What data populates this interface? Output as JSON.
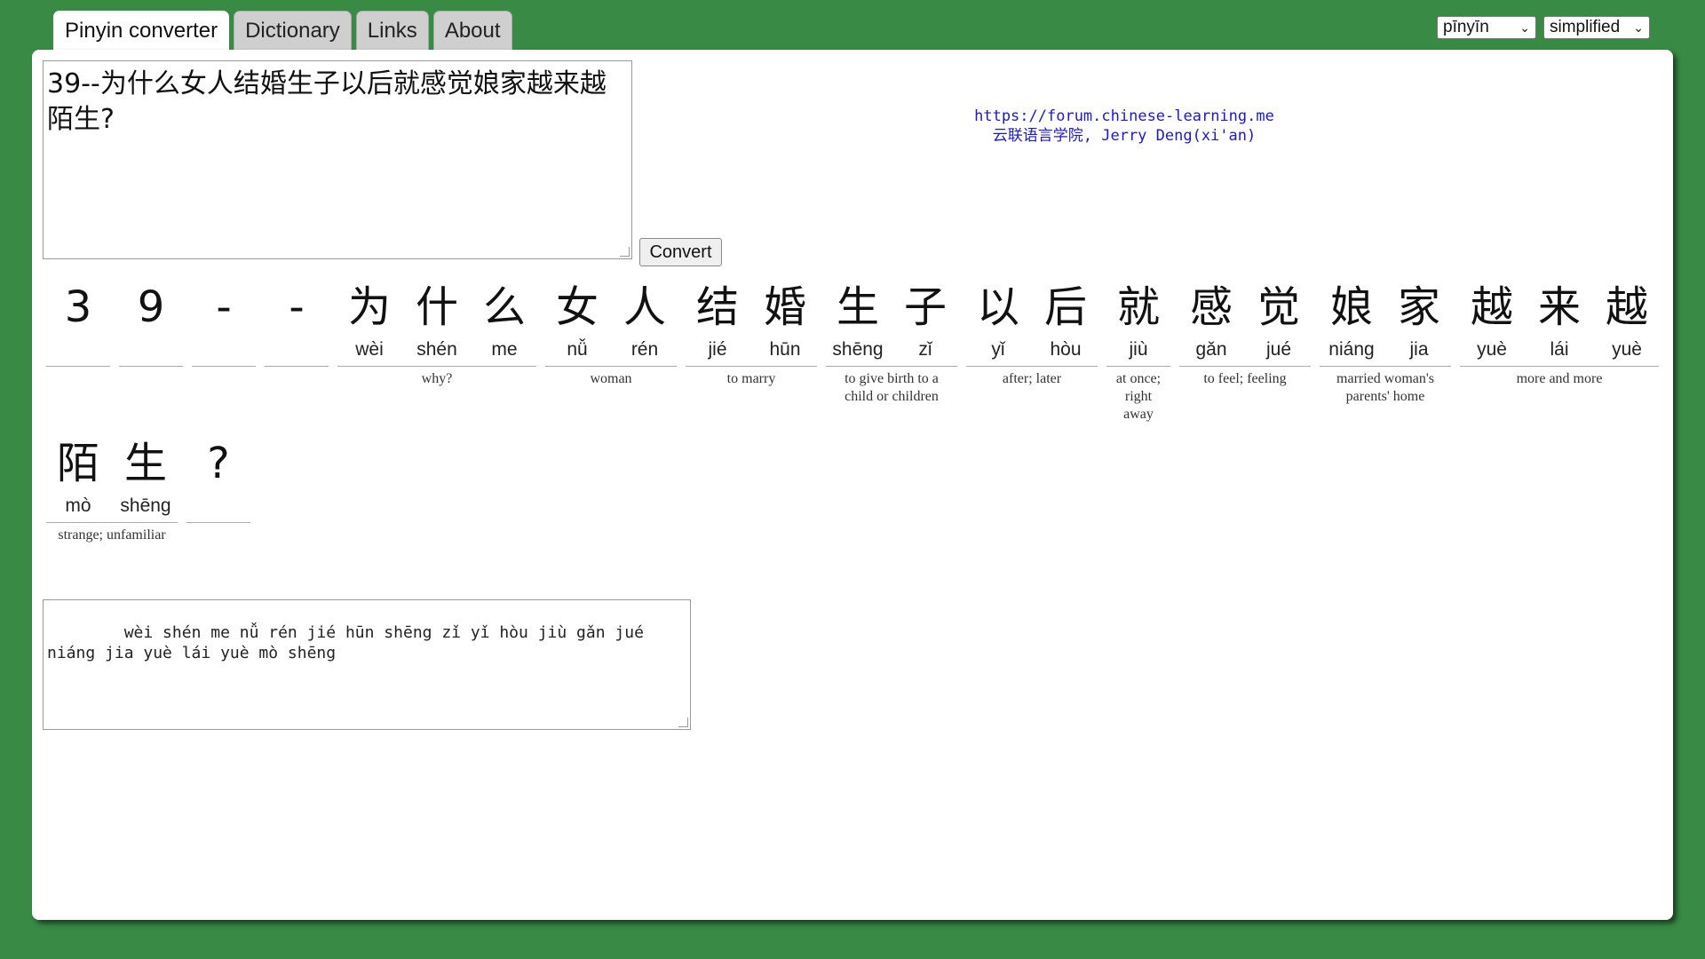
{
  "tabs": [
    "Pinyin converter",
    "Dictionary",
    "Links",
    "About"
  ],
  "selects": {
    "mode": "pīnyīn",
    "script": "simplified"
  },
  "input_text": "39--为什么女人结婚生子以后就感觉娘家越来越陌生?",
  "convert_label": "Convert",
  "credits": {
    "url": "https://forum.chinese-learning.me",
    "attribution": "云联语言学院, Jerry Deng(xi'an)"
  },
  "row1": [
    {
      "chars": [
        {
          "hz": "3",
          "py": ""
        }
      ],
      "def": ""
    },
    {
      "chars": [
        {
          "hz": "9",
          "py": ""
        }
      ],
      "def": ""
    },
    {
      "chars": [
        {
          "hz": "-",
          "py": ""
        }
      ],
      "def": ""
    },
    {
      "chars": [
        {
          "hz": "-",
          "py": ""
        }
      ],
      "def": ""
    },
    {
      "chars": [
        {
          "hz": "为",
          "py": "wèi"
        },
        {
          "hz": "什",
          "py": "shén"
        },
        {
          "hz": "么",
          "py": "me"
        }
      ],
      "def": "why?"
    },
    {
      "chars": [
        {
          "hz": "女",
          "py": "nǚ"
        },
        {
          "hz": "人",
          "py": "rén"
        }
      ],
      "def": "woman"
    },
    {
      "chars": [
        {
          "hz": "结",
          "py": "jié"
        },
        {
          "hz": "婚",
          "py": "hūn"
        }
      ],
      "def": "to marry"
    },
    {
      "chars": [
        {
          "hz": "生",
          "py": "shēng"
        },
        {
          "hz": "子",
          "py": "zǐ"
        }
      ],
      "def": "to give birth to a child or children"
    },
    {
      "chars": [
        {
          "hz": "以",
          "py": "yǐ"
        },
        {
          "hz": "后",
          "py": "hòu"
        }
      ],
      "def": "after; later"
    },
    {
      "chars": [
        {
          "hz": "就",
          "py": "jiù"
        }
      ],
      "def": "at once; right away"
    },
    {
      "chars": [
        {
          "hz": "感",
          "py": "gǎn"
        },
        {
          "hz": "觉",
          "py": "jué"
        }
      ],
      "def": "to feel; feeling"
    },
    {
      "chars": [
        {
          "hz": "娘",
          "py": "niáng"
        },
        {
          "hz": "家",
          "py": "jia"
        }
      ],
      "def": "married woman's parents' home"
    },
    {
      "chars": [
        {
          "hz": "越",
          "py": "yuè"
        },
        {
          "hz": "来",
          "py": "lái"
        },
        {
          "hz": "越",
          "py": "yuè"
        }
      ],
      "def": "more and more"
    }
  ],
  "row2": [
    {
      "chars": [
        {
          "hz": "陌",
          "py": "mò"
        },
        {
          "hz": "生",
          "py": "shēng"
        }
      ],
      "def": "strange; unfamiliar"
    },
    {
      "chars": [
        {
          "hz": "?",
          "py": ""
        }
      ],
      "def": ""
    }
  ],
  "output_text": "    wèi shén me nǚ rén jié hūn shēng zǐ yǐ hòu jiù gǎn jué niáng jia yuè lái yuè mò shēng"
}
